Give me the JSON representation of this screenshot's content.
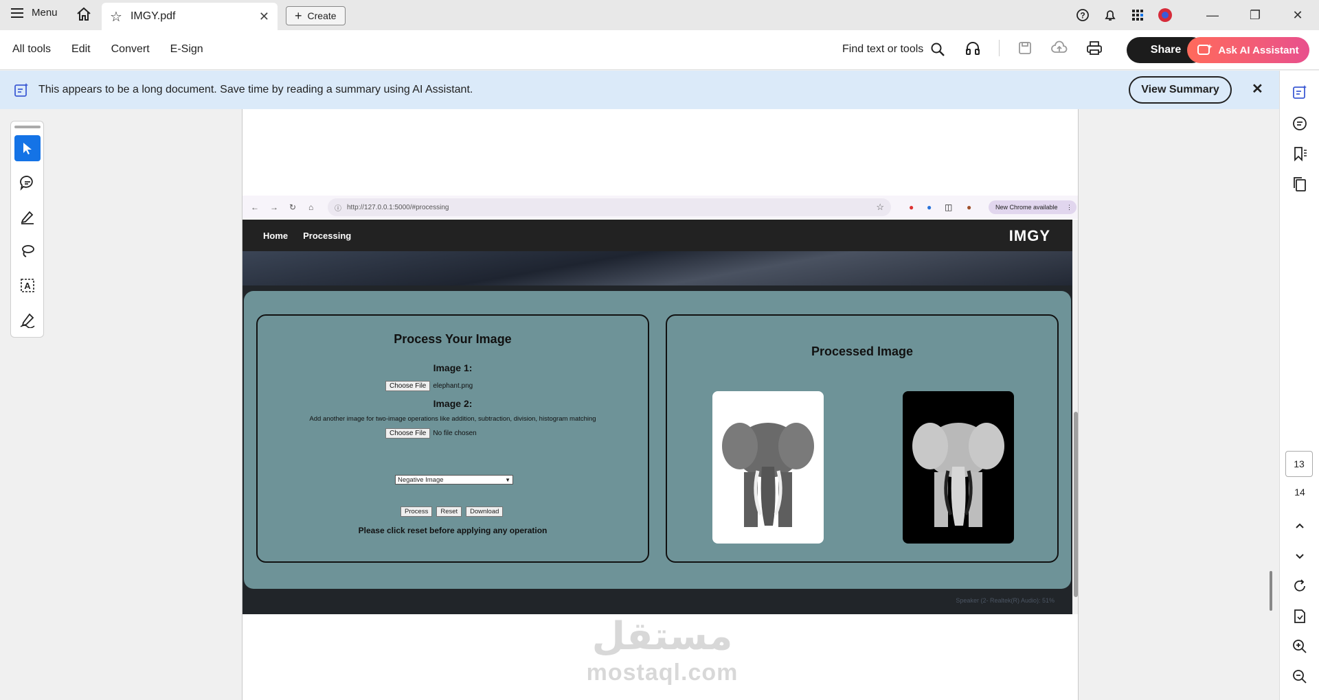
{
  "titlebar": {
    "menu_label": "Menu",
    "tab_title": "IMGY.pdf",
    "create_label": "Create"
  },
  "toolbar": {
    "menus": [
      "All tools",
      "Edit",
      "Convert",
      "E-Sign"
    ],
    "find_label": "Find text or tools",
    "share_label": "Share",
    "ai_label": "Ask AI Assistant"
  },
  "banner": {
    "text": "This appears to be a long document. Save time by reading a summary using AI Assistant.",
    "button": "View Summary"
  },
  "browser": {
    "url": "http://127.0.0.1:5000/#processing",
    "chrome_pill": "New Chrome available"
  },
  "site": {
    "nav_links": [
      "Home",
      "Processing"
    ],
    "brand": "IMGY",
    "left_card": {
      "title": "Process Your Image",
      "image1_label": "Image 1:",
      "choose_file": "Choose File",
      "file1_name": "elephant.png",
      "image2_label": "Image 2:",
      "helper": "Add another image for two-image operations like addition, subtraction, division, histogram matching",
      "file2_name": "No file chosen",
      "operation": "Negative Image",
      "buttons": [
        "Process",
        "Reset",
        "Download"
      ],
      "note": "Please click reset before applying any operation"
    },
    "right_card": {
      "title": "Processed Image"
    },
    "footer": "Speaker (2- Realtek(R) Audio): 51%"
  },
  "watermark": {
    "arabic": "مستقل",
    "latin": "mostaql.com"
  },
  "pages": {
    "current": "13",
    "next": "14"
  }
}
